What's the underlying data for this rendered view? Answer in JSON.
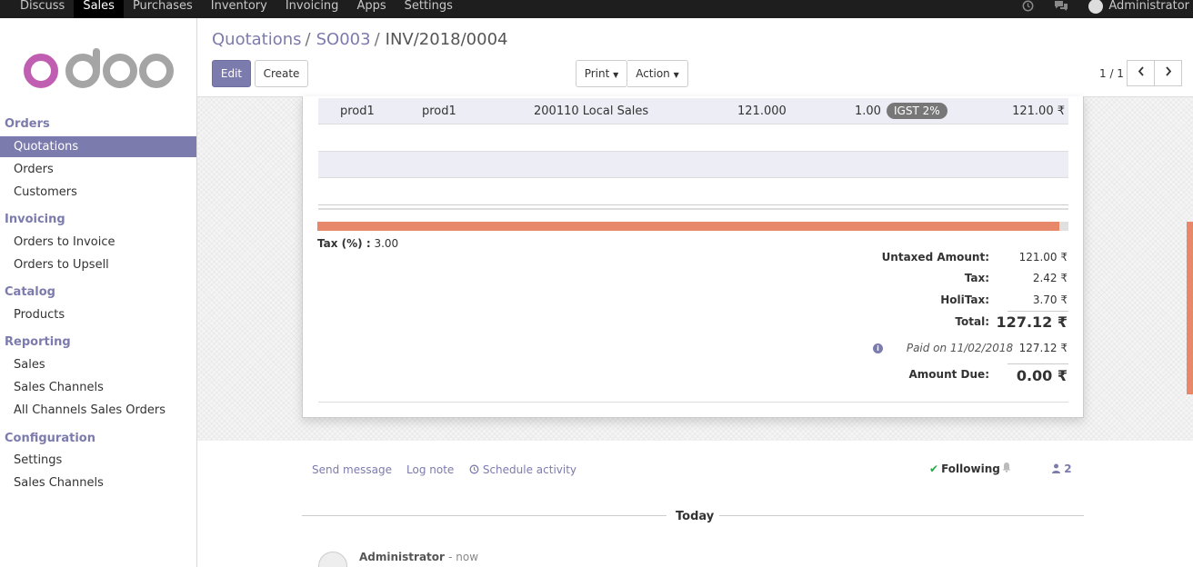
{
  "topnav": {
    "items": [
      "Discuss",
      "Sales",
      "Purchases",
      "Inventory",
      "Invoicing",
      "Apps",
      "Settings"
    ],
    "active": "Sales",
    "icons": [
      "clock-icon",
      "chat-icon"
    ],
    "user": "Administrator"
  },
  "brand": {
    "logo_text": "odoo",
    "accent": "#7c7bad",
    "logo_o_color": "#c05fb1",
    "logo_doo_color": "#a5a5a5"
  },
  "sidebar": {
    "sections": [
      {
        "title": "Orders",
        "items": [
          "Quotations",
          "Orders",
          "Customers"
        ]
      },
      {
        "title": "Invoicing",
        "items": [
          "Orders to Invoice",
          "Orders to Upsell"
        ]
      },
      {
        "title": "Catalog",
        "items": [
          "Products"
        ]
      },
      {
        "title": "Reporting",
        "items": [
          "Sales",
          "Sales Channels",
          "All Channels Sales Orders"
        ]
      },
      {
        "title": "Configuration",
        "items": [
          "Settings",
          "Sales Channels"
        ]
      }
    ],
    "active_item": "Quotations"
  },
  "breadcrumb": {
    "items": [
      "Quotations",
      "SO003"
    ],
    "separator": "/",
    "current": "INV/2018/0004"
  },
  "buttons": {
    "edit": "Edit",
    "create": "Create",
    "print": "Print",
    "action": "Action"
  },
  "pager": {
    "value": "1 / 1",
    "prev_icon": "chevron-left-icon",
    "next_icon": "chevron-right-icon"
  },
  "invoice_line": {
    "product": "prod1",
    "description": "prod1",
    "account": "200110 Local Sales",
    "quantity": "121.000",
    "price": "1.00",
    "tax": "IGST 2%",
    "subtotal": "121.00 ₹"
  },
  "tax_percent": {
    "label": "Tax (%) :",
    "value": "3.00"
  },
  "totals": {
    "untaxed_label": "Untaxed Amount:",
    "untaxed_value": "121.00 ₹",
    "tax_label": "Tax:",
    "tax_value": "2.42 ₹",
    "holitax_label": "HoliTax:",
    "holitax_value": "3.70 ₹",
    "total_label": "Total:",
    "total_value": "127.12 ₹",
    "payment_text": "Paid on 11/02/2018",
    "payment_value": "127.12 ₹",
    "due_label": "Amount Due:",
    "due_value": "0.00 ₹"
  },
  "chatter": {
    "send_message": "Send message",
    "log_note": "Log note",
    "schedule_activity": "Schedule activity",
    "following": "Following",
    "followers_count": "2",
    "date_separator": "Today",
    "message_author": "Administrator",
    "message_time": "- now"
  }
}
